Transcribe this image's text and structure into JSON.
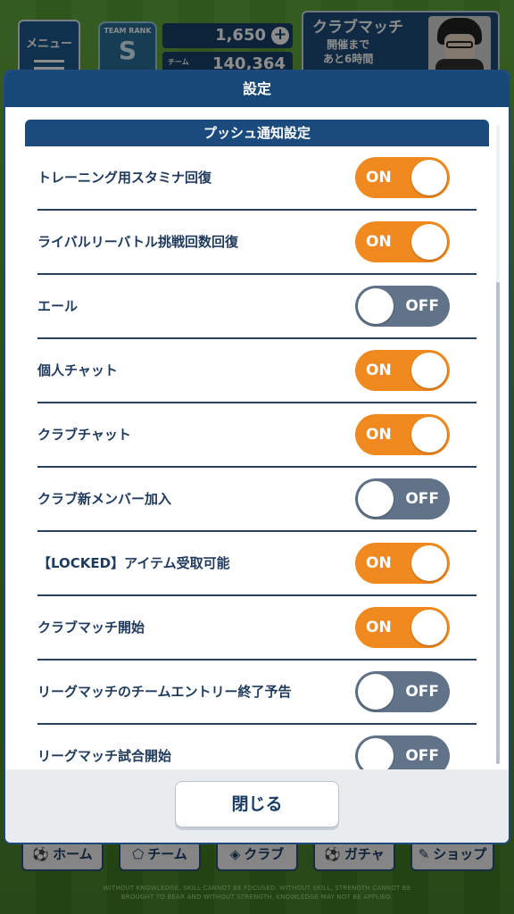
{
  "background": {
    "menu_label": "メニュー",
    "team_rank_label": "TEAM RANK",
    "team_rank_letter": "S",
    "currency_value": "1,650",
    "currency_plus": "+",
    "team_power_label": "チーム",
    "team_power_value": "140,364",
    "club_match_title": "クラブマッチ",
    "club_match_line1": "開催まで",
    "club_match_line2": "あと6時間",
    "nav": [
      {
        "label": "ホーム",
        "icon": "⚽"
      },
      {
        "label": "チーム",
        "icon": "⬠"
      },
      {
        "label": "クラブ",
        "icon": "◈"
      },
      {
        "label": "ガチャ",
        "icon": "⚽"
      },
      {
        "label": "ショップ",
        "icon": "✎"
      }
    ],
    "footer_text": "WITHOUT KNOWLEDGE, SKILL CANNOT BE FOCUSED. WITHOUT SKILL, STRENGTH CANNOT BE BROUGHT TO BEAR AND WITHOUT STRENGTH, KNOWLEDGE MAY NOT BE APPLIED."
  },
  "dialog": {
    "title": "設定",
    "section_title": "プッシュ通知設定",
    "close_label": "閉じる",
    "on_text": "ON",
    "off_text": "OFF",
    "settings": [
      {
        "label": "トレーニング用スタミナ回復",
        "state": "on"
      },
      {
        "label": "ライバルリーバトル挑戦回数回復",
        "state": "on"
      },
      {
        "label": "エール",
        "state": "off"
      },
      {
        "label": "個人チャット",
        "state": "on"
      },
      {
        "label": "クラブチャット",
        "state": "on"
      },
      {
        "label": "クラブ新メンバー加入",
        "state": "off"
      },
      {
        "label": "【LOCKED】アイテム受取可能",
        "state": "on"
      },
      {
        "label": "クラブマッチ開始",
        "state": "on"
      },
      {
        "label": "リーグマッチのチームエントリー終了予告",
        "state": "off"
      },
      {
        "label": "リーグマッチ試合開始",
        "state": "off"
      }
    ]
  },
  "colors": {
    "on": "#f08a1e",
    "off": "#617388",
    "header": "#164878",
    "text": "#1f3a5c"
  }
}
